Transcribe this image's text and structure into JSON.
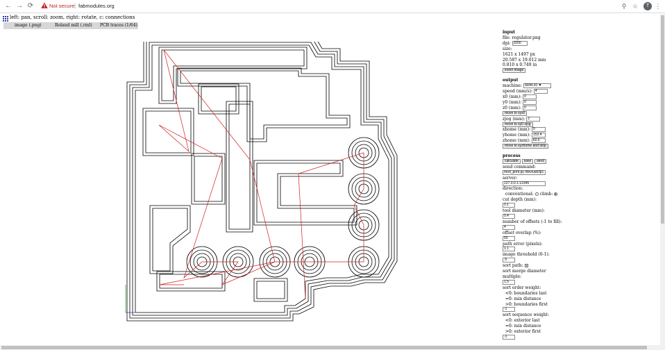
{
  "browser": {
    "security_label": "Not secure",
    "url": "fabmodules.org",
    "profile_initial": "T",
    "icons": [
      "back-icon",
      "forward-icon",
      "reload-icon",
      "warning-icon",
      "search-icon",
      "star-icon",
      "profile-icon",
      "menu-icon"
    ]
  },
  "page": {
    "hint": "left: pan, scroll: zoom, right: rotate, c: connections",
    "tabs": [
      "image (.png)",
      "Roland mill (.rml)",
      "PCB traces (1/64)"
    ]
  },
  "input": {
    "heading": "input",
    "file": "file: regulator.png",
    "dpi_label": "dpi:",
    "dpi_value": "2000",
    "size_label": "size:",
    "size_px": "1621 x 1497 px",
    "size_mm": "20.587 x 19.012 mm",
    "size_in": "0.810 x 0.749 in",
    "invert_button": "invert image"
  },
  "output": {
    "heading": "output",
    "machine_label": "machine:",
    "machine_value": "SRM-20 ▼",
    "speed_label": "speed (mm/s):",
    "speed_value": "4",
    "x0_label": "x0 (mm):",
    "x0_value": "0",
    "y0_label": "y0 (mm):",
    "y0_value": "0",
    "z0_label": "z0 (mm):",
    "z0_value": "0",
    "move_xyz0_button": "move to xyz0",
    "zjog_label": "zjog (mm):",
    "zjog_value": "2",
    "move_xy0_button": "move to xy0 zjog",
    "xhome_label": "xhome (mm):",
    "xhome_value": "0",
    "yhome_label": "yhome (mm):",
    "yhome_value": "152.4",
    "zhome_label": "zhome (mm):",
    "zhome_value": "60.5",
    "move_home_button": "move to xyzhome and stop"
  },
  "process": {
    "heading": "process",
    "calculate_button": "calculate",
    "save_button": "save",
    "send_button": "send",
    "send_command_label": "send command:",
    "send_command_value": "mod_print.py /dev/usb/lp1 ",
    "server_label": "server:",
    "server_value": "127.0.0.1:12345",
    "direction_label": "direction:",
    "conventional_label": "conventional:",
    "climb_label": "climb:",
    "cut_depth_label": "cut depth (mm):",
    "cut_depth_value": "0.1",
    "tool_diameter_label": "tool diameter (mm):",
    "tool_diameter_value": "0.4",
    "offsets_label": "number of offsets (-1 to fill):",
    "offsets_value": "4",
    "overlap_label": "offset overlap (%):",
    "overlap_value": "50",
    "path_error_label": "path error (pixels):",
    "path_error_value": "1.1",
    "threshold_label": "image threshold (0-1):",
    "threshold_value": ".5",
    "sort_path_label": "sort path:",
    "merge_label": "sort merge diameter multiple:",
    "merge_value": "1.5",
    "order_label": "sort order weight:",
    "order_lt": "<0: boundaries last",
    "order_eq": "=0: min distance",
    "order_gt": ">0: boundaries first",
    "order_value": "-1",
    "sequence_label": "sort sequence weight:",
    "seq_lt": "<0: exterior last",
    "seq_eq": "=0: min distance",
    "seq_gt": ">0: exterior first",
    "sequence_value": "-1"
  },
  "colors": {
    "toolpath": "#000000",
    "connection": "#d01c1c",
    "warning": "#c5221f",
    "tab_bar": "#d7d7d7"
  }
}
